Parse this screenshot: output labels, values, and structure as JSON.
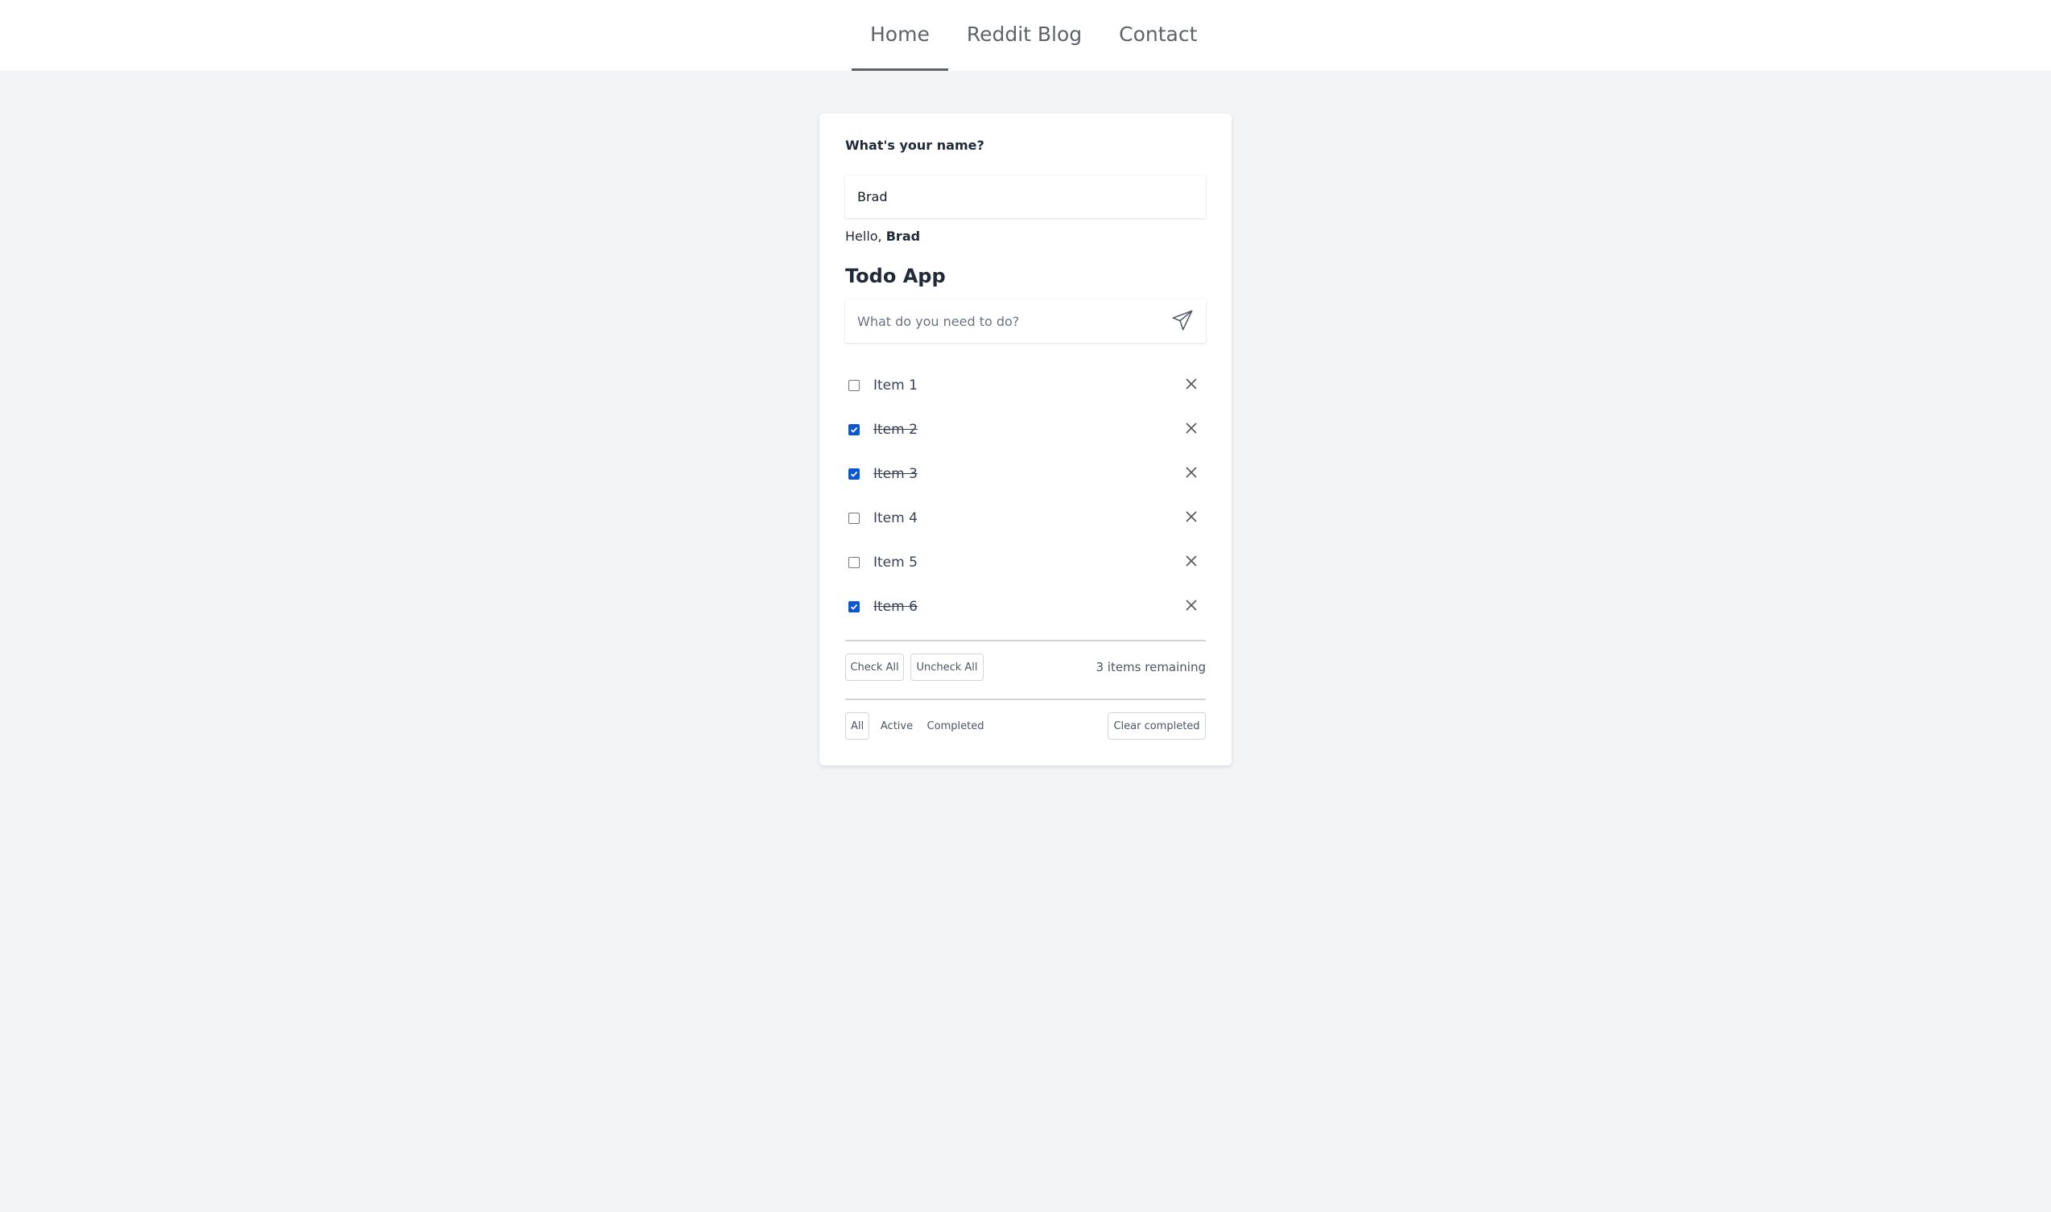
{
  "nav": {
    "items": [
      {
        "label": "Home",
        "active": true
      },
      {
        "label": "Reddit Blog",
        "active": false
      },
      {
        "label": "Contact",
        "active": false
      }
    ]
  },
  "name_section": {
    "label": "What's your name?",
    "input_value": "Brad",
    "greeting_prefix": "Hello, ",
    "greeting_name": "Brad"
  },
  "todo": {
    "title": "Todo App",
    "input_placeholder": "What do you need to do?",
    "input_value": "",
    "send_icon": "paper-plane-icon",
    "delete_icon": "close-icon",
    "accent_color": "#0b57d0",
    "items": [
      {
        "label": "Item 1",
        "completed": false
      },
      {
        "label": "Item 2",
        "completed": true
      },
      {
        "label": "Item 3",
        "completed": true
      },
      {
        "label": "Item 4",
        "completed": false
      },
      {
        "label": "Item 5",
        "completed": false
      },
      {
        "label": "Item 6",
        "completed": true
      }
    ],
    "check_all_label": "Check All",
    "uncheck_all_label": "Uncheck All",
    "remaining_text": "3 items remaining",
    "filters": [
      {
        "label": "All",
        "selected": true
      },
      {
        "label": "Active",
        "selected": false
      },
      {
        "label": "Completed",
        "selected": false
      }
    ],
    "clear_completed_label": "Clear completed"
  }
}
